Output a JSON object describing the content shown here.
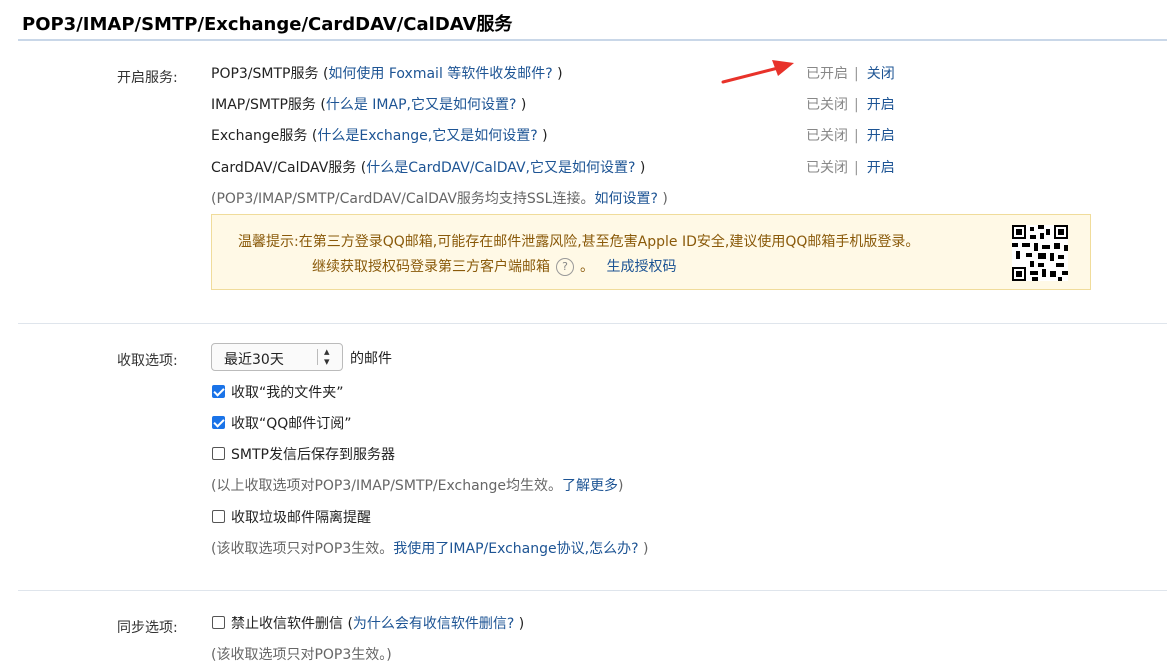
{
  "header": {
    "title": "POP3/IMAP/SMTP/Exchange/CardDAV/CalDAV服务"
  },
  "services": {
    "label": "开启服务:",
    "items": [
      {
        "name": "POP3/SMTP服务",
        "paren_open": " (",
        "link": "如何使用 Foxmail 等软件收发邮件?",
        "paren_close": " )",
        "status": "已开启",
        "pipe": "|",
        "action": "关闭"
      },
      {
        "name": "IMAP/SMTP服务",
        "paren_open": " (",
        "link": "什么是 IMAP,它又是如何设置?",
        "paren_close": " )",
        "status": "已关闭",
        "pipe": "|",
        "action": "开启"
      },
      {
        "name": "Exchange服务",
        "paren_open": " (",
        "link": "什么是Exchange,它又是如何设置?",
        "paren_close": " )",
        "status": "已关闭",
        "pipe": "|",
        "action": "开启"
      },
      {
        "name": "CardDAV/CalDAV服务",
        "paren_open": " (",
        "link": "什么是CardDAV/CalDAV,它又是如何设置?",
        "paren_close": " )",
        "status": "已关闭",
        "pipe": "|",
        "action": "开启"
      }
    ],
    "ssl_note_prefix": "(POP3/IMAP/SMTP/CardDAV/CalDAV服务均支持SSL连接。",
    "ssl_note_link": "如何设置?",
    "ssl_note_suffix": " )"
  },
  "warning": {
    "line1": "温馨提示:在第三方登录QQ邮箱,可能存在邮件泄露风险,甚至危害Apple ID安全,建议使用QQ邮箱手机版登录。",
    "line2": "继续获取授权码登录第三方客户端邮箱",
    "help_glyph": "?",
    "period": "。",
    "link": "生成授权码"
  },
  "receive": {
    "label": "收取选项:",
    "select_value": "最近30天",
    "select_suffix": "的邮件",
    "options": [
      {
        "text": "收取“我的文件夹”",
        "checked": true
      },
      {
        "text": "收取“QQ邮件订阅”",
        "checked": true
      },
      {
        "text": "SMTP发信后保存到服务器",
        "checked": false
      }
    ],
    "note1_prefix": "(以上收取选项对POP3/IMAP/SMTP/Exchange均生效。",
    "note1_link": "了解更多",
    "note1_suffix": ")",
    "spam_option": {
      "text": "收取垃圾邮件隔离提醒",
      "checked": false
    },
    "note2_prefix": "(该收取选项只对POP3生效。",
    "note2_link": "我使用了IMAP/Exchange协议,怎么办?",
    "note2_suffix": " )"
  },
  "sync": {
    "label": "同步选项:",
    "option": {
      "text": "禁止收信软件删信",
      "checked": false
    },
    "option_paren_open": " (",
    "option_link": "为什么会有收信软件删信?",
    "option_paren_close": " )",
    "note": "(该收取选项只对POP3生效。)"
  },
  "colors": {
    "link": "#1d5494",
    "arrow": "#e8322a",
    "checkbox": "#1a73e8",
    "warning_bg": "#fff9e6"
  }
}
